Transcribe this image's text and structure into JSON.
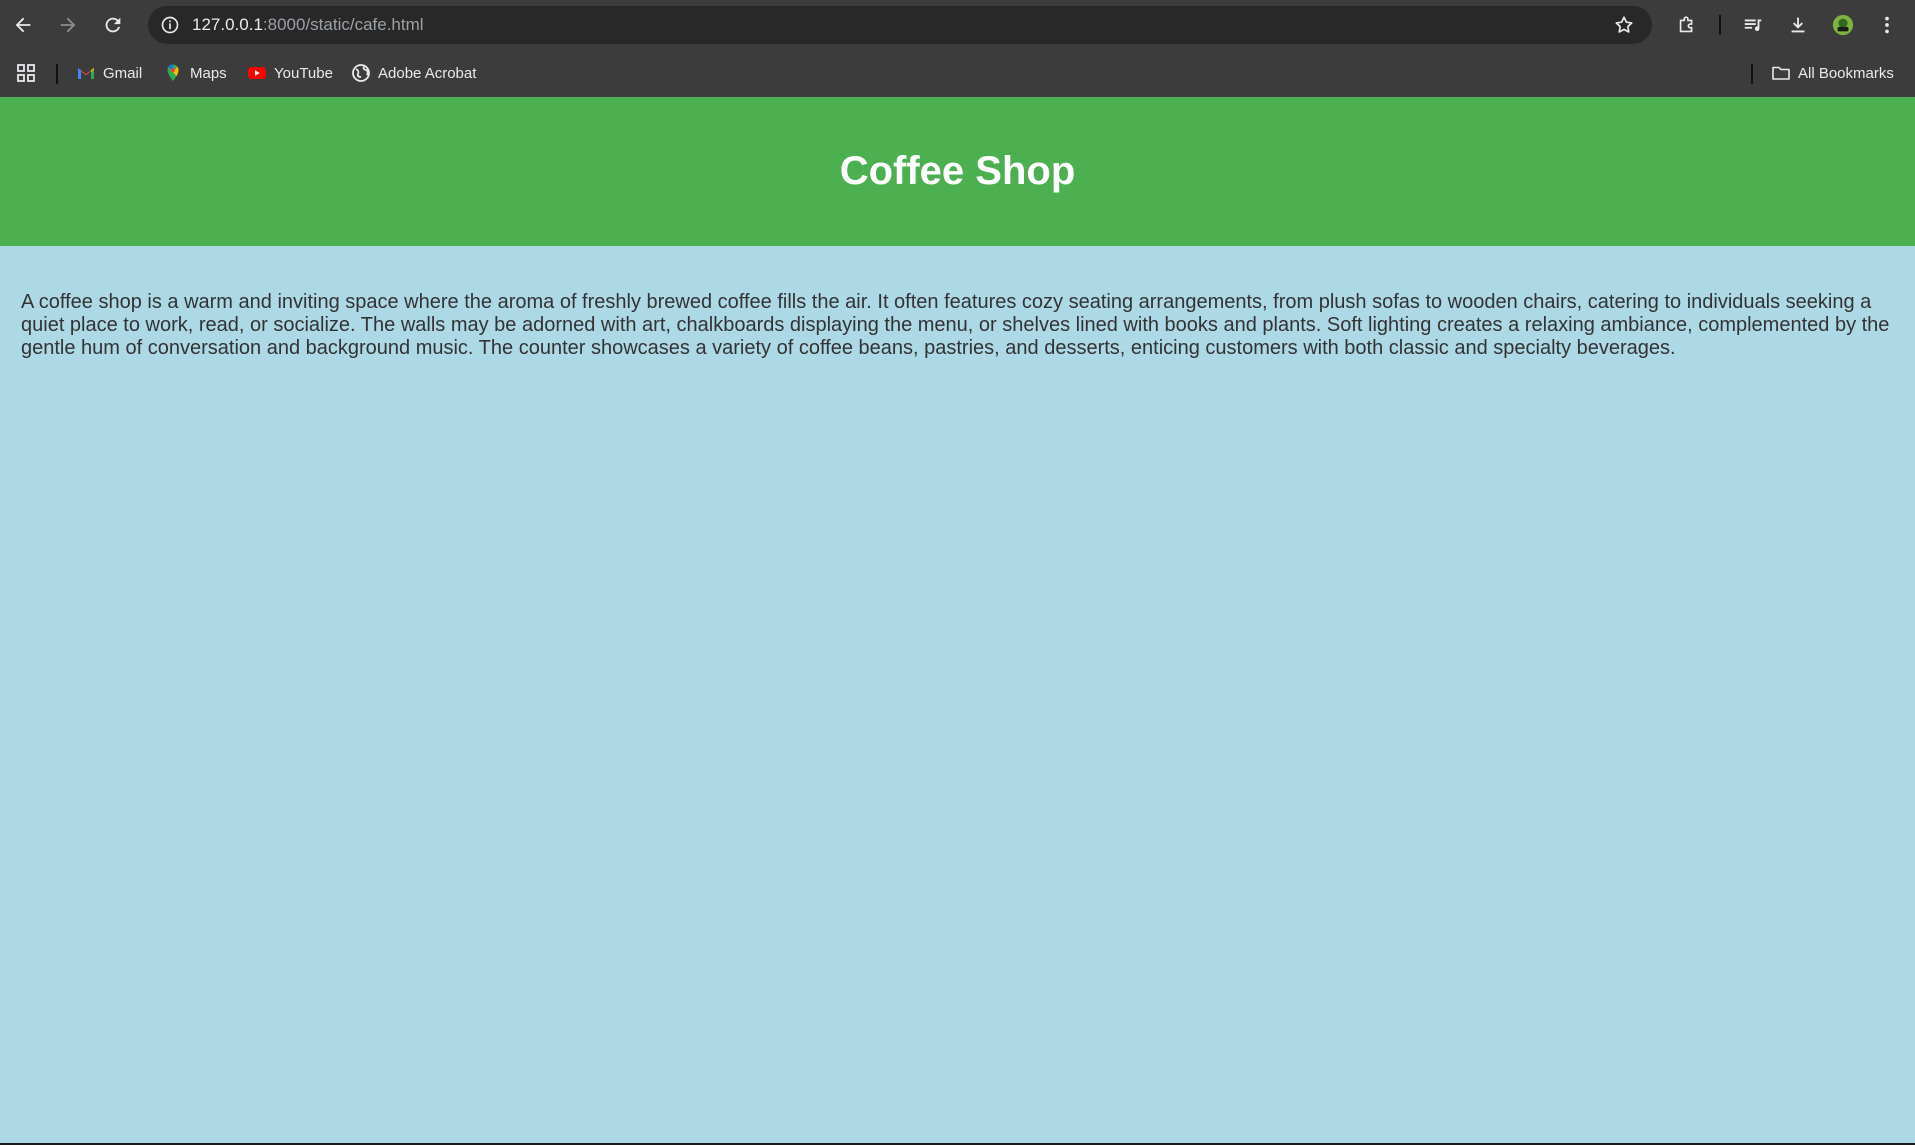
{
  "browser": {
    "url_host": "127.0.0.1",
    "url_path": ":8000/static/cafe.html",
    "bookmarks": [
      {
        "label": "Gmail",
        "icon": "gmail-icon"
      },
      {
        "label": "Maps",
        "icon": "maps-icon"
      },
      {
        "label": "YouTube",
        "icon": "youtube-icon"
      },
      {
        "label": "Adobe Acrobat",
        "icon": "globe-icon"
      }
    ],
    "all_bookmarks_label": "All Bookmarks"
  },
  "page": {
    "title": "Coffee Shop",
    "description": "A coffee shop is a warm and inviting space where the aroma of freshly brewed coffee fills the air. It often features cozy seating arrangements, from plush sofas to wooden chairs, catering to individuals seeking a quiet place to work, read, or socialize. The walls may be adorned with art, chalkboards displaying the menu, or shelves lined with books and plants. Soft lighting creates a relaxing ambiance, complemented by the gentle hum of conversation and background music. The counter showcases a variety of coffee beans, pastries, and desserts, enticing customers with both classic and specialty beverages."
  },
  "colors": {
    "header_bg": "#4caf50",
    "body_bg": "#add8e6",
    "chrome_bg": "#3c3c3c"
  }
}
